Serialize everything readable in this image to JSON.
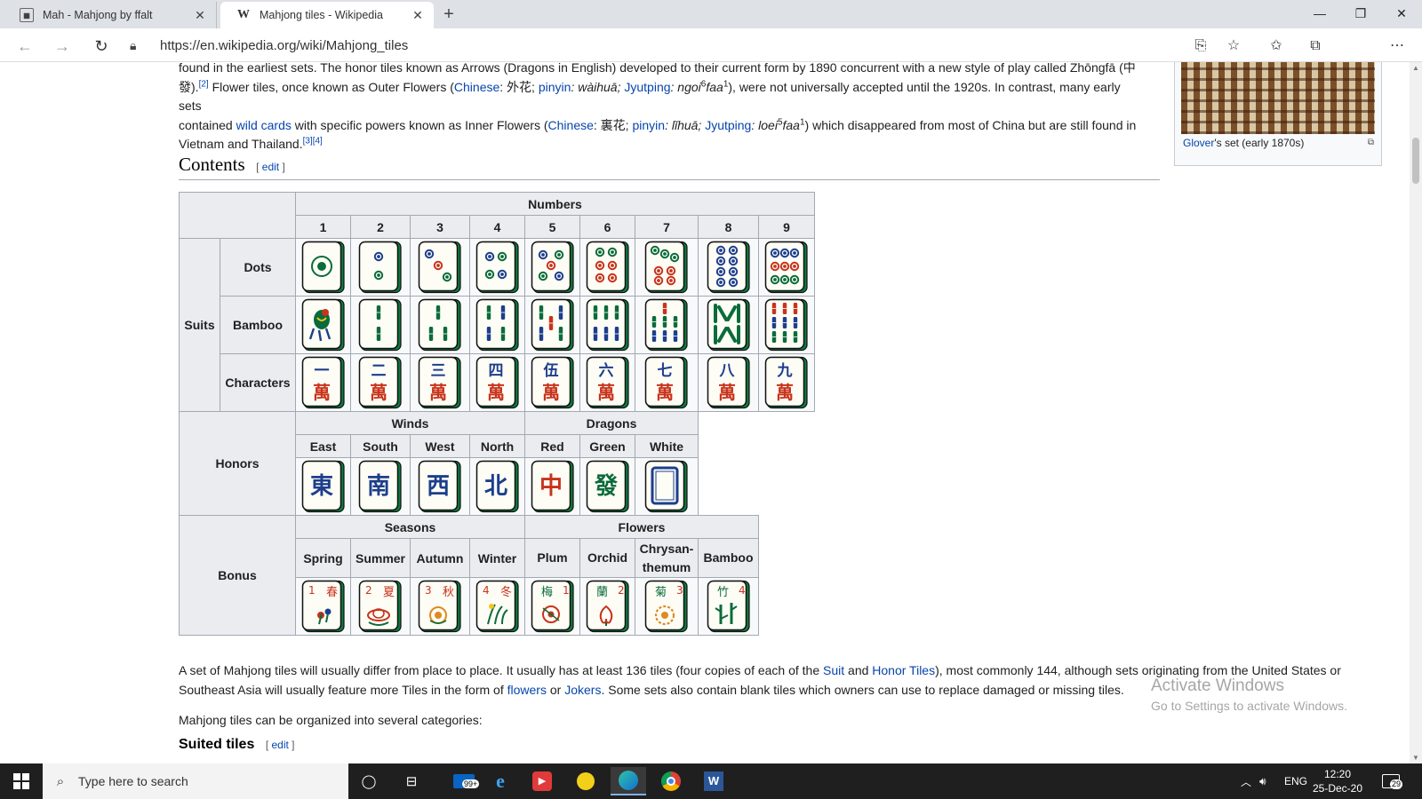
{
  "browser": {
    "tabs": [
      {
        "title": "Mah - Mahjong by ffalt",
        "active": false
      },
      {
        "title": "Mahjong tiles - Wikipedia",
        "active": true
      }
    ],
    "url": "https://en.wikipedia.org/wiki/Mahjong_tiles"
  },
  "article": {
    "intro_line1": "found in the earliest sets. The honor tiles known as Arrows (Dragons in English) developed to their current form by 1890 concurrent with a new style of play called Zhōngfā (中",
    "intro_line2_a": "發).",
    "intro_line2_ref": "[2]",
    "intro_line2_b": " Flower tiles, once known as Outer Flowers (",
    "intro_line2_chinese": "Chinese",
    "intro_line2_c": ": 外花; ",
    "intro_line2_pinyin": "pinyin",
    "intro_line2_d": ": wàihuā; ",
    "intro_line2_jyutping": "Jyutping",
    "intro_line2_e": ": ngoi",
    "intro_line2_sup1": "6",
    "intro_line2_f": "faa",
    "intro_line2_sup2": "1",
    "intro_line2_g": "), were not universally accepted until the 1920s. In contrast, many early sets",
    "intro_line3_a": "contained ",
    "intro_line3_wild": "wild cards",
    "intro_line3_b": " with specific powers known as Inner Flowers (",
    "intro_line3_chinese": "Chinese",
    "intro_line3_c": ": 裏花; ",
    "intro_line3_pinyin": "pinyin",
    "intro_line3_d": ": lǐhuā; ",
    "intro_line3_jyutping": "Jyutping",
    "intro_line3_e": ": loei",
    "intro_line3_sup1": "5",
    "intro_line3_f": "faa",
    "intro_line3_sup2": "1",
    "intro_line3_g": ") which disappeared from most of China but are still found in",
    "intro_line4": "Vietnam and Thailand.",
    "intro_line4_ref": "[3][4]",
    "infobox_caption_link": "Glover",
    "infobox_caption_rest": "'s set (early 1870s)",
    "contents_title": "Contents",
    "edit_open": "[ ",
    "edit_label": "edit",
    "edit_close": " ]",
    "para2_a": "A set of Mahjong tiles will usually differ from place to place. It usually has at least 136 tiles (four copies of each of the ",
    "para2_suit": "Suit",
    "para2_b": " and ",
    "para2_honor": "Honor Tiles",
    "para2_c": "), most commonly 144, although sets originating from the United States or",
    "para2_d": "Southeast Asia will usually feature more Tiles in the form of ",
    "para2_flowers": "flowers",
    "para2_e": " or ",
    "para2_jokers": "Jokers",
    "para2_f": ". Some sets also contain blank tiles which owners can use to replace damaged or missing tiles.",
    "para3": "Mahjong tiles can be organized into several categories:",
    "suited_heading": "Suited tiles"
  },
  "table": {
    "numbers_header": "Numbers",
    "numbers": [
      "1",
      "2",
      "3",
      "4",
      "5",
      "6",
      "7",
      "8",
      "9"
    ],
    "suits_label": "Suits",
    "dots_label": "Dots",
    "bamboo_label": "Bamboo",
    "characters_label": "Characters",
    "honors_label": "Honors",
    "winds_header": "Winds",
    "dragons_header": "Dragons",
    "winds": [
      "East",
      "South",
      "West",
      "North"
    ],
    "dragons": [
      "Red",
      "Green",
      "White"
    ],
    "bonus_label": "Bonus",
    "seasons_header": "Seasons",
    "flowers_header": "Flowers",
    "seasons": [
      "Spring",
      "Summer",
      "Autumn",
      "Winter"
    ],
    "flowers": [
      "Plum",
      "Orchid",
      "Chrysan-\nthemum",
      "Bamboo"
    ],
    "characters_numerals": [
      "一",
      "二",
      "三",
      "四",
      "伍",
      "六",
      "七",
      "八",
      "九"
    ],
    "characters_wan": "萬",
    "wind_glyphs": [
      "東",
      "南",
      "西",
      "北"
    ],
    "dragon_glyphs": [
      "中",
      "發"
    ],
    "season_glyphs": [
      "春",
      "夏",
      "秋",
      "冬"
    ],
    "flower_glyphs": [
      "梅",
      "蘭",
      "菊",
      "竹"
    ],
    "bonus_numbers": [
      "1",
      "2",
      "3",
      "4"
    ]
  },
  "watermark": {
    "line1": "Activate Windows",
    "line2": "Go to Settings to activate Windows."
  },
  "taskbar": {
    "search_placeholder": "Type here to search",
    "mail_badge": "99+",
    "lang": "ENG",
    "time": "12:20",
    "date": "25-Dec-20",
    "notif_count": "29"
  },
  "colors": {
    "link": "#0645ad",
    "tile_green": "#0b6b3a",
    "tile_red": "#c8331b",
    "tile_blue": "#1d3e8c"
  }
}
